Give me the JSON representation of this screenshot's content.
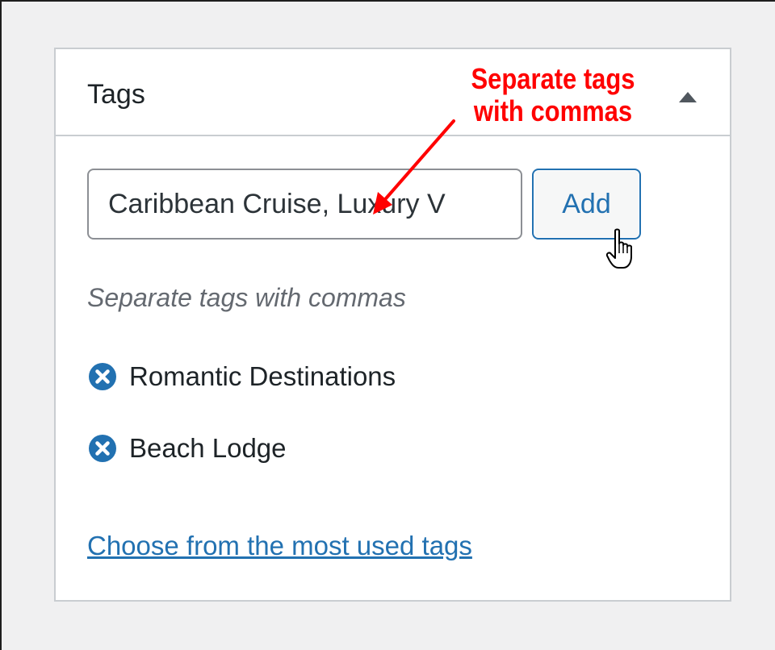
{
  "panel": {
    "title": "Tags",
    "toggle_icon": "triangle-up-icon"
  },
  "tag_input": {
    "value": "Caribbean Cruise, Luxury V"
  },
  "add_button": {
    "label": "Add"
  },
  "hint": {
    "text": "Separate tags with commas"
  },
  "tags": [
    {
      "label": "Romantic Destinations",
      "remove_icon": "remove-circle-x-icon"
    },
    {
      "label": "Beach Lodge",
      "remove_icon": "remove-circle-x-icon"
    }
  ],
  "most_used_link": {
    "label": "Choose from the most used tags"
  },
  "annotation": {
    "line1": "Separate tags",
    "line2": "with commas",
    "color": "#ff0000"
  },
  "colors": {
    "accent": "#2271b1",
    "remove_icon": "#2271b1",
    "border": "#c9cdd1"
  },
  "cursor": {
    "icon": "hand-pointer-icon"
  }
}
